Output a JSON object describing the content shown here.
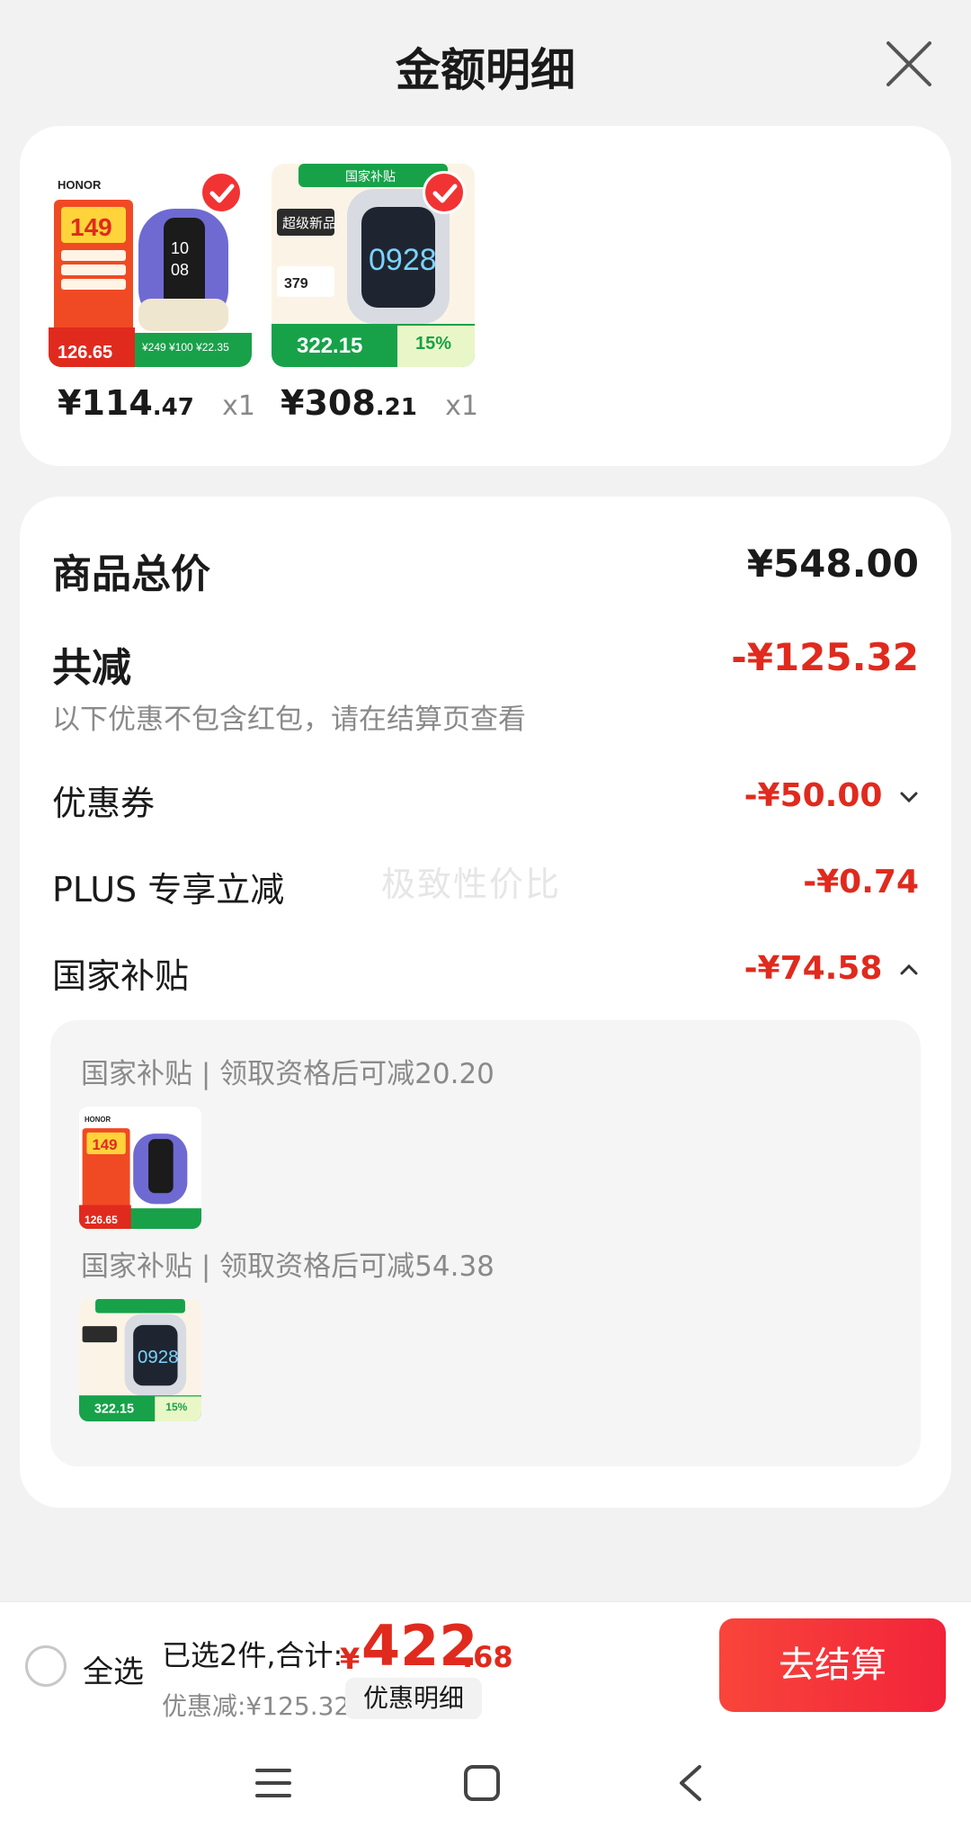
{
  "header": {
    "title": "金额明细"
  },
  "products": [
    {
      "price_int": "¥114",
      "price_dec": ".47",
      "qty": "x1",
      "brand": "HONOR",
      "promo_price": "149",
      "badge_price": "126.65"
    },
    {
      "price_int": "¥308",
      "price_dec": ".21",
      "qty": "x1",
      "banner": "国家补贴",
      "tag": "超级新品",
      "promo_price": "322.15",
      "discount": "15%"
    }
  ],
  "summary": {
    "total_label": "商品总价",
    "total_value": "¥548.00",
    "reduce_label": "共减",
    "reduce_value": "-¥125.32",
    "note": "以下优惠不包含红包，请在结算页查看",
    "coupon_label": "优惠券",
    "coupon_value": "-¥50.00",
    "plus_label": "PLUS 专享立减",
    "plus_value": "-¥0.74",
    "subsidy_label": "国家补贴",
    "subsidy_value": "-¥74.58",
    "watermark": "极致性价比",
    "subsidy_items": [
      {
        "text": "国家补贴 | 领取资格后可减20.20"
      },
      {
        "text": "国家补贴 | 领取资格后可减54.38"
      }
    ]
  },
  "bottom": {
    "select_all": "全选",
    "selected_text": "已选2件,合计:",
    "total_currency": "¥",
    "total_int": "422",
    "total_dec": ".68",
    "discount_text": "优惠减:¥125.32",
    "detail_label": "优惠明细",
    "checkout_label": "去结算"
  },
  "colors": {
    "accent": "#e02a1e",
    "button": "#f2303a"
  }
}
